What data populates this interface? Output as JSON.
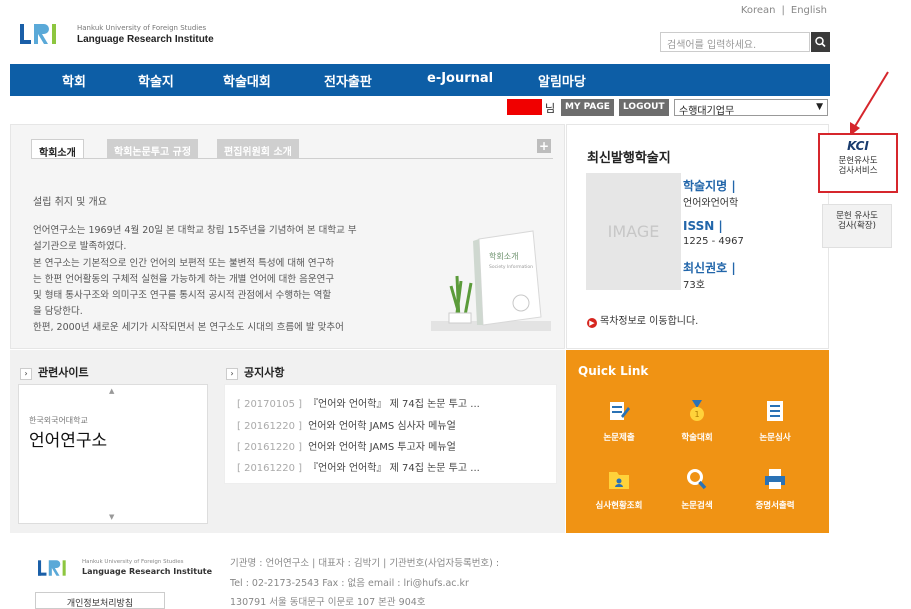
{
  "header": {
    "lang_korean": "Korean",
    "lang_sep": "|",
    "lang_english": "English",
    "logo_mark": "LRI",
    "logo_sub": "Hankuk University of Foreign Studies",
    "logo_main": "Language Research Institute",
    "search_placeholder": "검색어를 입력하세요."
  },
  "nav": {
    "items": [
      "학회",
      "학술지",
      "학술대회",
      "전자출판",
      "e-Journal",
      "알림마당"
    ]
  },
  "user": {
    "suffix": "님",
    "mypage": "MY PAGE",
    "logout": "LOGOUT",
    "role": "수행대기업무"
  },
  "intro": {
    "tabs": [
      "학회소개",
      "학회논문투고 규정",
      "편집위원회 소개"
    ],
    "plus": "+",
    "title": "설립 취지 및 개요",
    "lines": [
      "언어연구소는 1969년 4월 20일 본 대학교 창립 15주년을 기념하여 본 대학교 부",
      "설기관으로 발족하였다.",
      "본 연구소는 기본적으로 인간 언어의 보편적 또는 불변적 특성에 대해 연구하",
      "는 한편 언어활동의 구체적 실현을 가능하게 하는 개별 언어에 대한 음운연구",
      "및 형태 통사구조와 의미구조 연구를 통시적 공시적 관점에서 수행하는 역할",
      "을 담당한다.",
      "한편, 2000년 새로운 세기가 시작되면서 본 연구소도 시대의 흐름에 발 맞추어"
    ],
    "book_title": "학회소개",
    "book_sub": "Society Information"
  },
  "issue": {
    "title": "최신발행학술지",
    "image_text": "IMAGE",
    "name_label": "학술지명 |",
    "name_value": "언어와언어학",
    "issn_label": "ISSN |",
    "issn_value": "1225 - 4967",
    "latest_label": "최신권호 |",
    "latest_value": "73호",
    "link": "목차정보로 이동합니다."
  },
  "side": {
    "kci_logo": "KCI",
    "kci_text_1": "문헌유사도",
    "kci_text_2": "검사서비스",
    "ext_text_1": "문헌 유사도",
    "ext_text_2": "검사(확장)"
  },
  "sites": {
    "title": "관련사이트",
    "small": "한국외국어대학교",
    "big": "언어연구소"
  },
  "notices": {
    "title": "공지사항",
    "items": [
      {
        "date": "[ 20170105 ]",
        "text": "『언어와 언어학』 제 74집 논문 투고 ..."
      },
      {
        "date": "[ 20161220 ]",
        "text": "언어와 언어학 JAMS 심사자 메뉴얼"
      },
      {
        "date": "[ 20161220 ]",
        "text": "언어와 언어학 JAMS 투고자 메뉴얼"
      },
      {
        "date": "[ 20161220 ]",
        "text": "『언어와 언어학』 제 74집 논문 투고 ..."
      }
    ]
  },
  "quick": {
    "title": "Quick Link",
    "items": [
      "논문제출",
      "학술대회",
      "논문심사",
      "심사현황조회",
      "논문검색",
      "증명서출력"
    ]
  },
  "footer": {
    "line1": "기관명 : 언어연구소 | 대표자 : 김박기 | 기관번호(사업자등록번호) :",
    "line2": "Tel : 02-2173-2543 Fax : 없음 email : lri@hufs.ac.kr",
    "line3": "130791 서울 동대문구 이문로 107 본관 904호",
    "privacy": "개인정보처리방침"
  },
  "colors": {
    "nav": "#0d5ea6",
    "quick": "#f09314",
    "kci_border": "#d6262c",
    "link_blue": "#2266aa"
  }
}
